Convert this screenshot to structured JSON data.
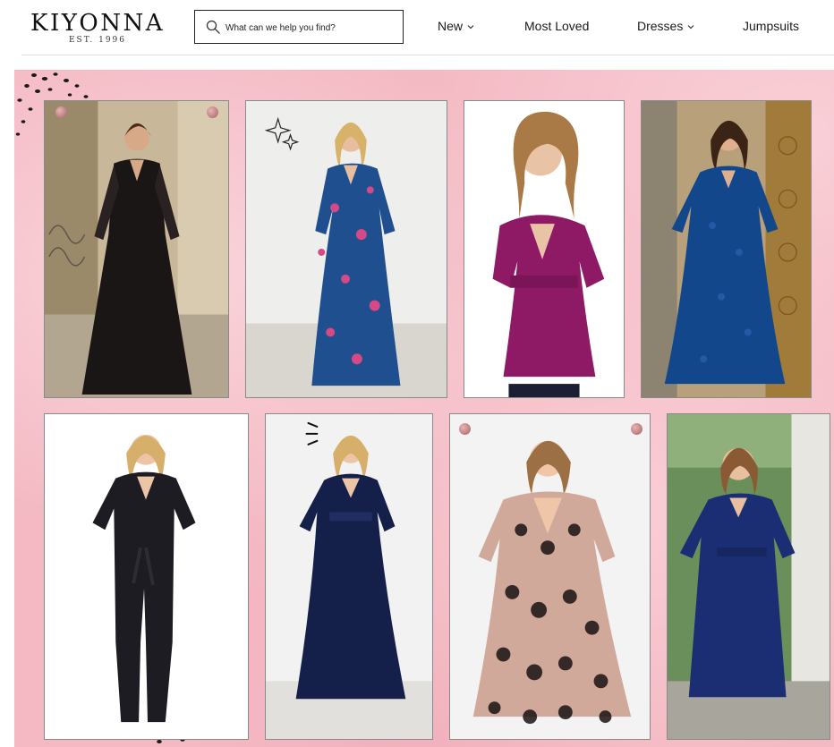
{
  "brand": {
    "name": "KIYONNA",
    "tagline": "EST. 1996"
  },
  "search": {
    "placeholder": "What can we help you find?",
    "value": ""
  },
  "icons": {
    "search": "search-icon",
    "chevron": "chevron-down-icon"
  },
  "nav": {
    "items": [
      {
        "label": "New",
        "has_dropdown": true
      },
      {
        "label": "Most Loved",
        "has_dropdown": false
      },
      {
        "label": "Dresses",
        "has_dropdown": true
      },
      {
        "label": "Jumpsuits",
        "has_dropdown": false
      }
    ]
  },
  "colors": {
    "hero_background": "#f4b9c3",
    "text": "#1a1a1a",
    "pin": "#b87a7e"
  },
  "gallery": {
    "photos": [
      {
        "subject": "black lace maxi dress",
        "garment_color": "#1a1616",
        "backdrop": "#c9b79a"
      },
      {
        "subject": "blue floral print maxi dress",
        "garment_color": "#1f4f8f",
        "backdrop": "#eeeeec"
      },
      {
        "subject": "magenta peplum top",
        "garment_color": "#8e1a66",
        "backdrop": "#ffffff"
      },
      {
        "subject": "blue lace dress",
        "garment_color": "#13478c",
        "backdrop": "#b7a07a"
      },
      {
        "subject": "black wrap jumpsuit",
        "garment_color": "#1c1c22",
        "backdrop": "#ffffff"
      },
      {
        "subject": "navy velvet maxi dress",
        "garment_color": "#14204a",
        "backdrop": "#f2f2f2"
      },
      {
        "subject": "black lace dress over nude lining",
        "garment_color": "#1a1313",
        "backdrop": "#f3f3f3"
      },
      {
        "subject": "navy wrap dress",
        "garment_color": "#1b2e74",
        "backdrop": "#6b8f5a"
      }
    ]
  }
}
